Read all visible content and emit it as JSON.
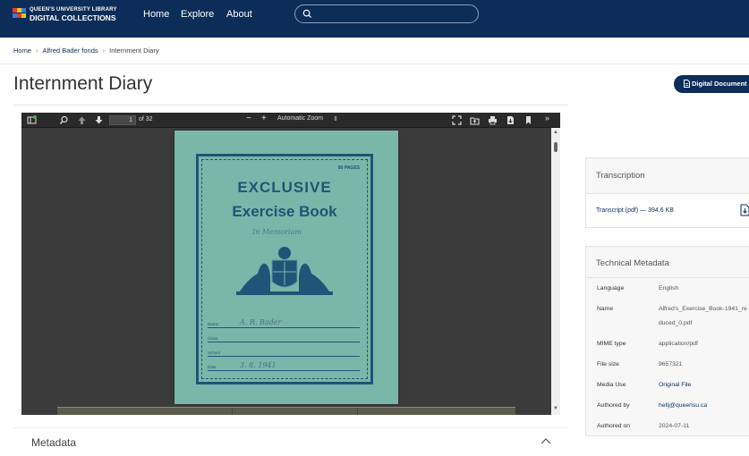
{
  "header": {
    "logo_line1": "QUEEN'S UNIVERSITY LIBRARY",
    "logo_line2": "DIGITAL COLLECTIONS",
    "nav": [
      "Home",
      "Explore",
      "About"
    ],
    "search_placeholder": ""
  },
  "breadcrumb": [
    "Home",
    "Alfred Bader fonds",
    "Internment Diary"
  ],
  "page_title": "Internment Diary",
  "digital_document_button": "Digital Document",
  "viewer": {
    "page_number": "1",
    "page_total": "of 32",
    "zoom": "Automatic Zoom",
    "notebook": {
      "pages_label": "80 PAGES",
      "title1": "EXCLUSIVE",
      "title2": "Exercise Book",
      "handwriting_top": "In Memoriam",
      "fields": [
        "Name",
        "Class",
        "School",
        "Date"
      ],
      "name_value": "A. R. Bader",
      "date_value": "3. 8. 1941"
    }
  },
  "metadata_heading": "Metadata",
  "transcription": {
    "heading": "Transcription",
    "link": "Transcript (pdf) — 394.6 KB"
  },
  "technical_metadata": {
    "heading": "Technical Metadata",
    "rows": [
      {
        "label": "Language",
        "value": "English"
      },
      {
        "label": "Name",
        "value": "Alfred's_Exercise_Book-1941_reduced_0.pdf"
      },
      {
        "label": "MIME type",
        "value": "application/pdf"
      },
      {
        "label": "File size",
        "value": "9657321"
      },
      {
        "label": "Media Use",
        "value": "Original File"
      },
      {
        "label": "Authored by",
        "value": "hellj@queensu.ca"
      },
      {
        "label": "Authored on",
        "value": "2024-07-11"
      }
    ]
  },
  "colors": {
    "nav_bg": "#0c2d57",
    "link": "#0c2d57",
    "notebook": "#79b7a9",
    "notebook_ink": "#1f5576"
  }
}
